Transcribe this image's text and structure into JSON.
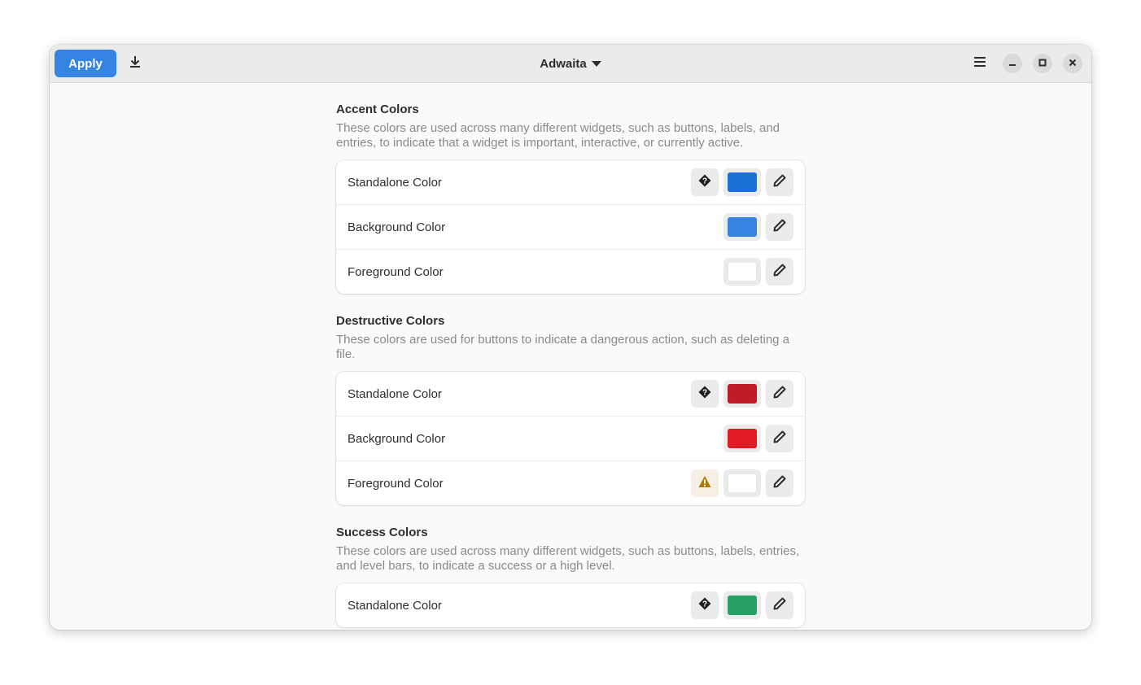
{
  "window": {
    "title": "Adwaita",
    "apply_label": "Apply",
    "icons": {
      "download": "download-icon",
      "title_dropdown": "triangle-down-icon",
      "menu": "hamburger-menu-icon",
      "minimize": "minimize-icon",
      "maximize": "maximize-icon",
      "close": "close-icon"
    }
  },
  "colors": {
    "accent": "#3584e4"
  },
  "sections": [
    {
      "title": "Accent Colors",
      "description": "These colors are used across many different widgets, such as buttons, labels, and entries, to indicate that a widget is important, interactive, or currently active.",
      "rows": [
        {
          "label": "Standalone Color",
          "badge": "help",
          "color": "#1c71d8"
        },
        {
          "label": "Background Color",
          "badge": null,
          "color": "#3584e4"
        },
        {
          "label": "Foreground Color",
          "badge": null,
          "color": "#ffffff"
        }
      ]
    },
    {
      "title": "Destructive Colors",
      "description": "These colors are used for buttons to indicate a dangerous action, such as deleting a file.",
      "rows": [
        {
          "label": "Standalone Color",
          "badge": "help",
          "color": "#c01c28"
        },
        {
          "label": "Background Color",
          "badge": null,
          "color": "#e01b24"
        },
        {
          "label": "Foreground Color",
          "badge": "warning",
          "color": "#ffffff"
        }
      ]
    },
    {
      "title": "Success Colors",
      "description": "These colors are used across many different widgets, such as buttons, labels, entries, and level bars, to indicate a success or a high level.",
      "rows": [
        {
          "label": "Standalone Color",
          "badge": "help",
          "color": "#26a269"
        }
      ]
    }
  ]
}
